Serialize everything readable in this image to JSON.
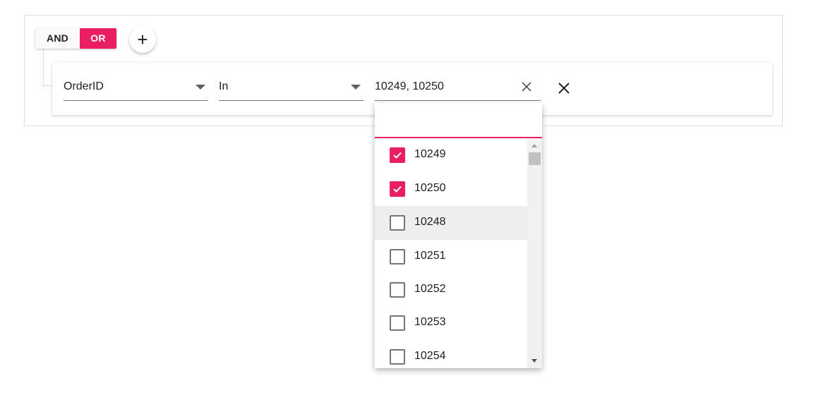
{
  "group": {
    "and_label": "AND",
    "or_label": "OR",
    "active": "OR",
    "accent_color": "#e91e63"
  },
  "add_button": {
    "icon": "plus-icon",
    "label": "+"
  },
  "rule": {
    "field": "OrderID",
    "operator": "In",
    "value": "10249, 10250",
    "clear_icon": "close-icon",
    "delete_icon": "close-icon"
  },
  "popup": {
    "search_value": "",
    "items": [
      {
        "label": "10249",
        "checked": true
      },
      {
        "label": "10250",
        "checked": true
      },
      {
        "label": "10248",
        "checked": false,
        "hovered": true
      },
      {
        "label": "10251",
        "checked": false
      },
      {
        "label": "10252",
        "checked": false
      },
      {
        "label": "10253",
        "checked": false
      },
      {
        "label": "10254",
        "checked": false
      }
    ]
  }
}
